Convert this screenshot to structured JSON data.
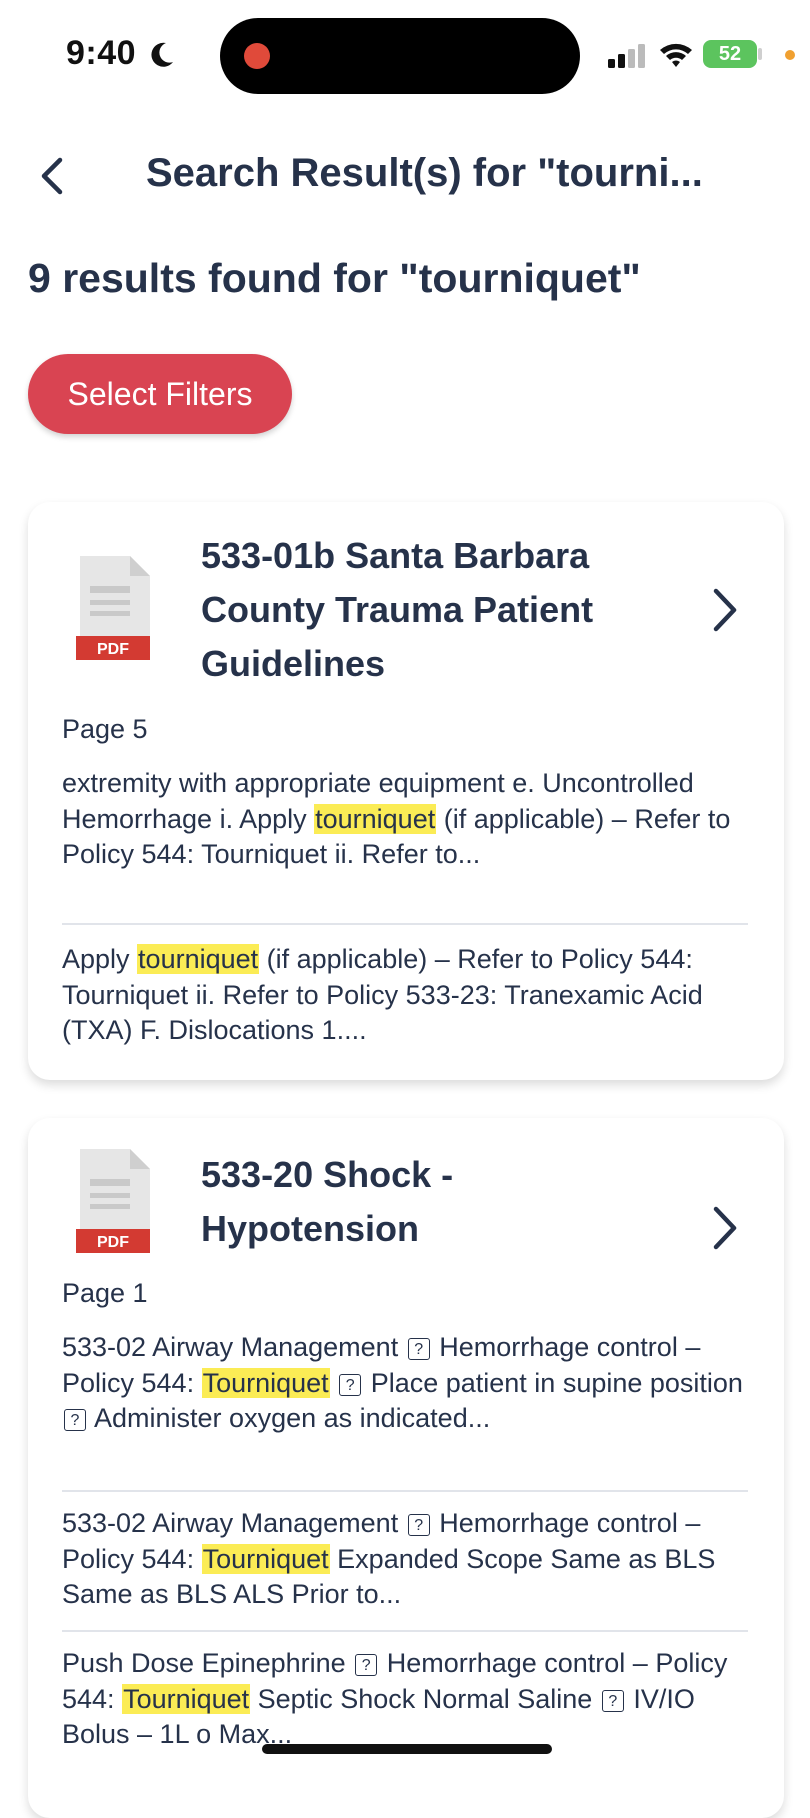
{
  "status_bar": {
    "time": "9:40",
    "battery": "52",
    "icons": [
      "moon-icon",
      "signal-icon",
      "wifi-icon",
      "battery-icon"
    ]
  },
  "header": {
    "back_icon": "chevron-left-icon",
    "title": "Search Result(s) for \"tourni..."
  },
  "results_count": "9 results found for \"tourniquet\"",
  "filter_button": {
    "label": "Select Filters",
    "color": "#d94452"
  },
  "highlight_color": "#fbec55",
  "cards": [
    {
      "file_type_icon": "pdf-file-icon",
      "file_type_label": "PDF",
      "title": "533-01b Santa Barbara County Trauma Patient Guidelines",
      "page": "Page 5",
      "snippets": [
        [
          {
            "t": "extremity with appropriate equipment e. Uncontrolled Hemorrhage i. Apply "
          },
          {
            "t": "tourniquet",
            "hl": true
          },
          {
            "t": " (if applicable) – Refer to Policy 544: Tourniquet ii. Refer to..."
          }
        ],
        [
          {
            "t": "Apply "
          },
          {
            "t": "tourniquet",
            "hl": true
          },
          {
            "t": " (if applicable) – Refer to Policy 544: Tourniquet ii. Refer to Policy 533-23: Tranexamic Acid (TXA) F. Dislocations 1...."
          }
        ]
      ]
    },
    {
      "file_type_icon": "pdf-file-icon",
      "file_type_label": "PDF",
      "title": "533-20 Shock - Hypotension",
      "page": "Page 1",
      "snippets": [
        [
          {
            "t": "533-02 Airway Management "
          },
          {
            "q": "?"
          },
          {
            "t": " Hemorrhage control – Policy 544: "
          },
          {
            "t": "Tourniquet",
            "hl": true
          },
          {
            "t": " "
          },
          {
            "q": "?"
          },
          {
            "t": " Place patient in supine position "
          },
          {
            "q": "?"
          },
          {
            "t": " Administer oxygen as indicated..."
          }
        ],
        [
          {
            "t": "533-02 Airway Management "
          },
          {
            "q": "?"
          },
          {
            "t": " Hemorrhage control – Policy 544: "
          },
          {
            "t": "Tourniquet",
            "hl": true
          },
          {
            "t": " Expanded Scope Same as BLS Same as BLS ALS Prior to..."
          }
        ],
        [
          {
            "t": "Push Dose Epinephrine "
          },
          {
            "q": "?"
          },
          {
            "t": " Hemorrhage control – Policy 544: "
          },
          {
            "t": "Tourniquet",
            "hl": true
          },
          {
            "t": " Septic Shock Normal Saline "
          },
          {
            "q": "?"
          },
          {
            "t": " IV/IO Bolus – 1L o Max..."
          }
        ]
      ]
    }
  ]
}
